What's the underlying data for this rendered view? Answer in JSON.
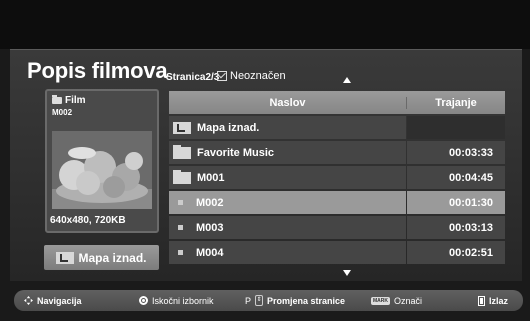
{
  "header": {
    "title": "Popis filmova",
    "page_info": "Stranica2/3",
    "mark_status": "Neoznačen"
  },
  "preview": {
    "type_label": "Film",
    "name": "M002",
    "resolution": "640x480, 720KB"
  },
  "parent_button": {
    "label": "Mapa iznad."
  },
  "list": {
    "columns": [
      "Naslov",
      "Trajanje"
    ],
    "rows": [
      {
        "icon": "folder-up-icon",
        "title": "Mapa iznad.",
        "duration": ""
      },
      {
        "icon": "folder-icon",
        "title": "Favorite Music",
        "duration": "00:03:33"
      },
      {
        "icon": "folder-icon",
        "title": "M001",
        "duration": "00:04:45"
      },
      {
        "icon": "bullet-icon",
        "title": "M002",
        "duration": "00:01:30",
        "selected": true
      },
      {
        "icon": "bullet-icon",
        "title": "M003",
        "duration": "00:03:13"
      },
      {
        "icon": "bullet-icon",
        "title": "M004",
        "duration": "00:02:51"
      }
    ]
  },
  "footer": {
    "navigation": "Navigacija",
    "popup_menu": "Iskočni izbornik",
    "page_key": "P",
    "page_change": "Promjena stranice",
    "mark_key": "MARK",
    "mark": "Označi",
    "exit": "Izlaz"
  },
  "colors": {
    "background": "#1a1a1a",
    "panel": "#333333",
    "row": "#454545",
    "selected_row": "#9a9a9a",
    "header": "#8e8e8e"
  }
}
